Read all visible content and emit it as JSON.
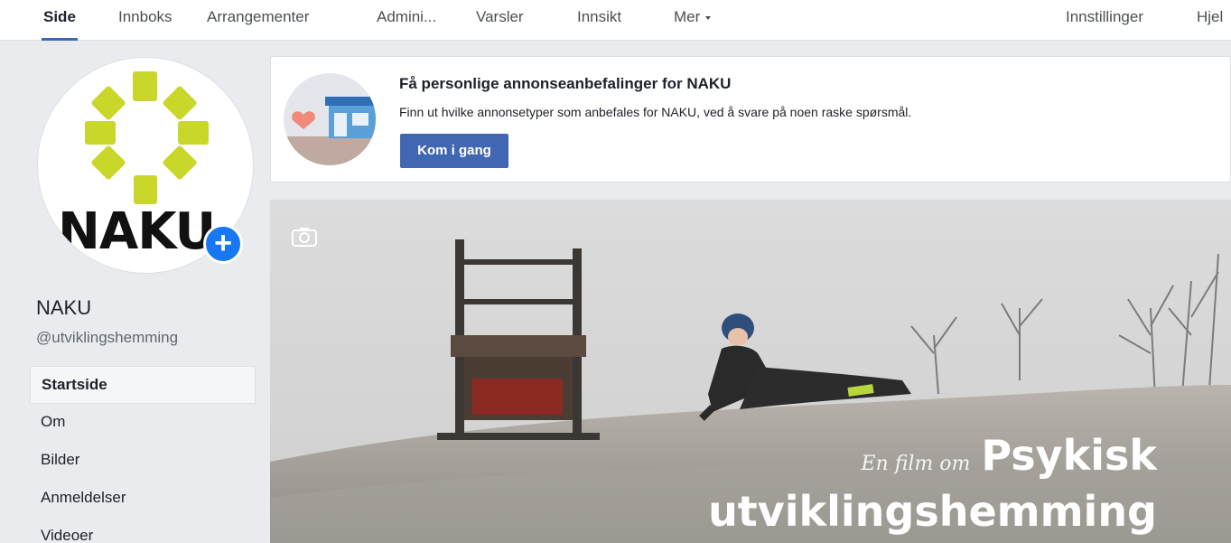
{
  "nav": {
    "tabs": [
      {
        "label": "Side"
      },
      {
        "label": "Innboks"
      },
      {
        "label": "Arrangementer"
      },
      {
        "label": "Admini..."
      },
      {
        "label": "Varsler"
      },
      {
        "label": "Innsikt"
      },
      {
        "label": "Mer"
      }
    ],
    "settings": "Innstillinger",
    "help": "Hjel"
  },
  "profile": {
    "logo_text": "NAKU",
    "name": "NAKU",
    "handle": "@utviklingshemming"
  },
  "sidebar": {
    "items": [
      {
        "label": "Startside"
      },
      {
        "label": "Om"
      },
      {
        "label": "Bilder"
      },
      {
        "label": "Anmeldelser"
      },
      {
        "label": "Videoer"
      }
    ]
  },
  "promo": {
    "title": "Få personlige annonseanbefalinger for NAKU",
    "description": "Finn ut hvilke annonsetyper som anbefales for NAKU, ved å svare på noen raske spørsmål.",
    "button": "Kom i gang"
  },
  "cover": {
    "caption_lead": "En film om",
    "caption_line1": "Psykisk",
    "caption_line2": "utviklingshemming"
  },
  "colors": {
    "accent": "#4267b2",
    "logo_green": "#c9d72b",
    "add_button": "#1877f2"
  }
}
